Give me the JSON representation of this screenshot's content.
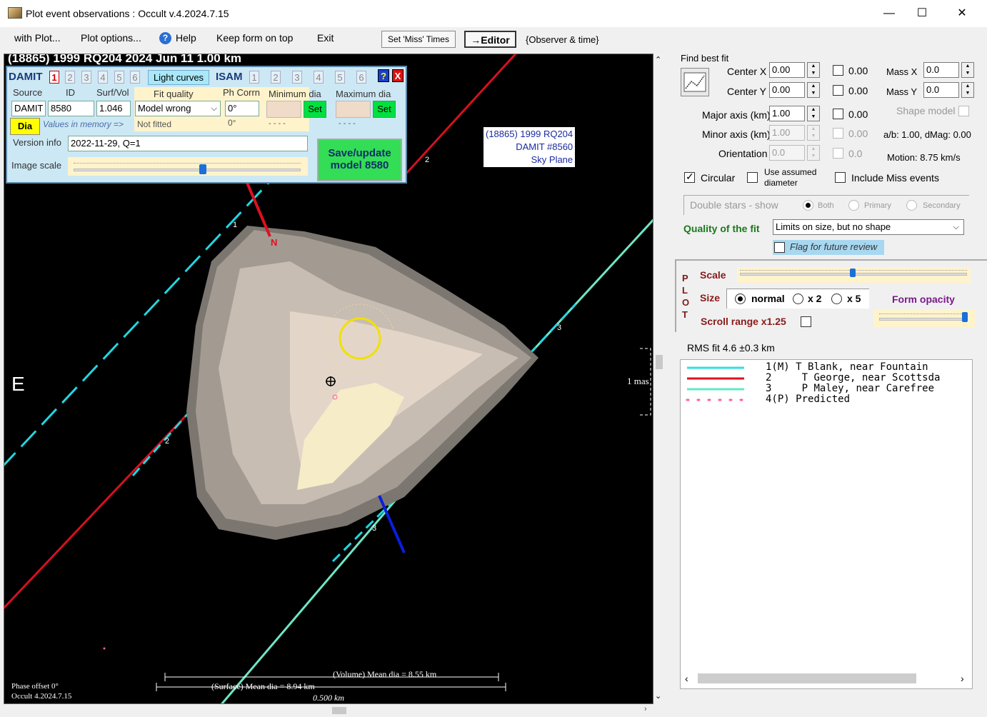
{
  "window": {
    "title": "Plot event observations : Occult v.4.2024.7.15",
    "minimize": "—",
    "maximize": "☐",
    "close": "✕"
  },
  "menu": {
    "with_plot": "with Plot...",
    "plot_options": "Plot options...",
    "help": "Help",
    "keep_form": "Keep form on top",
    "exit": "Exit",
    "set_miss": "Set 'Miss' Times",
    "editor": "→Editor",
    "observer_time": "{Observer & time}"
  },
  "plot": {
    "title": "(18865) 1999 RQ204  2024 Jun 11   1.00 km",
    "east": "E",
    "north": "N",
    "info_line1": "(18865) 1999 RQ204",
    "info_line2": "DAMIT #8560",
    "info_line3": "Sky Plane",
    "scale_mas": "1 mas",
    "chord_labels": [
      "1",
      "2",
      "2",
      "3",
      "3"
    ],
    "volume_dia": "(Volume) Mean dia = 8.55 km",
    "surface_dia": "(Surface) Mean dia = 8.94 km",
    "scale_km": "0.500 km",
    "phase_offset": "Phase offset 0°",
    "occult_version": "Occult 4.2024.7.15"
  },
  "damit_panel": {
    "damit_label": "DAMIT",
    "damit_tabs": [
      "1",
      "2",
      "3",
      "4",
      "5",
      "6"
    ],
    "light_curves": "Light curves",
    "isam_label": "ISAM",
    "isam_tabs": [
      "1",
      "2",
      "3",
      "4",
      "5",
      "6"
    ],
    "help_btn": "?",
    "close_btn": "X",
    "source_hdr": "Source",
    "id_hdr": "ID",
    "surf_hdr": "Surf/Vol",
    "fit_quality_hdr": "Fit quality",
    "ph_corr_hdr": "Ph Corrn",
    "min_dia_hdr": "Minimum dia",
    "max_dia_hdr": "Maximum dia",
    "source_val": "DAMIT",
    "id_val": "8580",
    "surf_val": "1.046",
    "fit_quality_val": "Model wrong",
    "ph_corr_val": "0°",
    "set": "Set",
    "dia_btn": "Dia",
    "values_memory": "Values in memory =>",
    "not_fitted": "Not fitted",
    "ph_corr_mem": "0°",
    "min_mem": "- - - -",
    "max_mem": "- - - -",
    "version_label": "Version info",
    "version_val": "2022-11-29, Q=1",
    "image_scale": "Image scale",
    "save_btn_line1": "Save/update",
    "save_btn_line2": "model 8580"
  },
  "fit": {
    "find_best_fit": "Find best fit",
    "center_x_label": "Center X",
    "center_x": "0.00",
    "center_x_chk": "0.00",
    "center_y_label": "Center Y",
    "center_y": "0.00",
    "center_y_chk": "0.00",
    "mass_x_label": "Mass X",
    "mass_x": "0.0",
    "mass_y_label": "Mass Y",
    "mass_y": "0.0",
    "major_label": "Major axis (km)",
    "major": "1.00",
    "major_chk": "0.00",
    "minor_label": "Minor axis (km)",
    "minor": "1.00",
    "minor_chk": "0.00",
    "orient_label": "Orientation",
    "orient": "0.0",
    "orient_chk": "0.0",
    "shape_model": "Shape model",
    "ab_dmag": "a/b: 1.00, dMag: 0.00",
    "motion": "Motion: 8.75 km/s",
    "circular": "Circular",
    "use_assumed_1": "Use assumed",
    "use_assumed_2": "diameter",
    "include_miss": "Include Miss events",
    "double_stars": "Double stars - show",
    "both": "Both",
    "primary": "Primary",
    "secondary": "Secondary",
    "quality_label": "Quality of the fit",
    "quality_val": "Limits on size, but no shape",
    "flag_review": "Flag for future review"
  },
  "plot_opts": {
    "side": [
      "P",
      "L",
      "O",
      "T"
    ],
    "scale": "Scale",
    "size": "Size",
    "normal": "normal",
    "x2": "x 2",
    "x5": "x 5",
    "form_opacity": "Form opacity",
    "scroll_range": "Scroll range x1.25",
    "scale_level": 0.45,
    "opacity_level": 0.95
  },
  "rms": "RMS fit 4.6 ±0.3 km",
  "legend": [
    {
      "num": "1(M)",
      "text": "T Blank, near Fountain",
      "color": "#2fe0e0"
    },
    {
      "num": "2",
      "text": "T George, near Scottsda",
      "color": "#e01020"
    },
    {
      "num": "3",
      "text": "P Maley, near Carefree",
      "color": "#60e8c8"
    },
    {
      "num": "4(P)",
      "text": "Predicted",
      "color": "#ff60a0"
    }
  ],
  "colors": {
    "cyan": "#22d6e0",
    "red": "#d51020",
    "teal": "#6ee6c6",
    "blue": "#0a1ee0",
    "yellow": "#f2e000"
  }
}
